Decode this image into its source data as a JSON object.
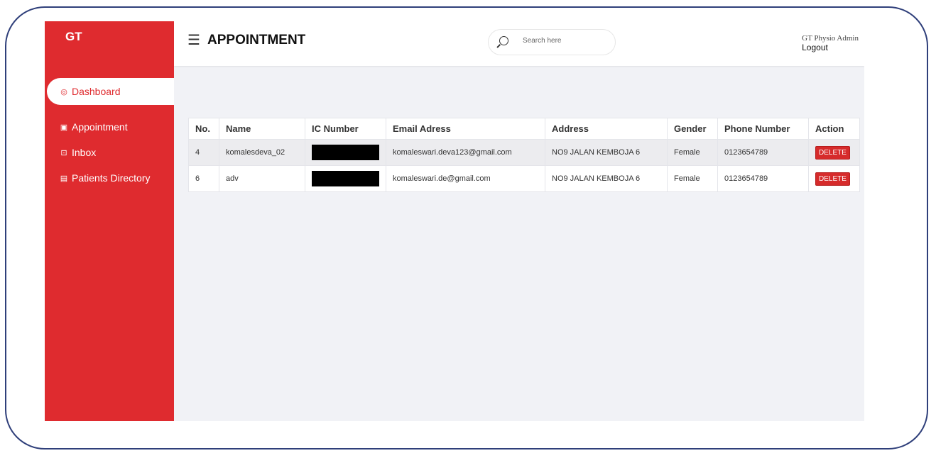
{
  "app": {
    "brand": "GT",
    "page_title": "APPOINTMENT"
  },
  "sidebar": {
    "items": [
      {
        "label": "Dashboard",
        "icon": "dashboard-icon",
        "active": true
      },
      {
        "label": "Appointment",
        "icon": "calendar-icon",
        "active": false
      },
      {
        "label": "Inbox",
        "icon": "chat-icon",
        "active": false
      },
      {
        "label": "Patients Directory",
        "icon": "contact-book-icon",
        "active": false
      }
    ]
  },
  "search": {
    "placeholder": "Search here"
  },
  "user": {
    "name": "GT Physio Admin",
    "logout": "Logout"
  },
  "table": {
    "headers": [
      "No.",
      "Name",
      "IC Number",
      "Email Adress",
      "Address",
      "Gender",
      "Phone Number",
      "Action"
    ],
    "rows": [
      {
        "no": "4",
        "name": "komalesdeva_02",
        "email": "komaleswari.deva123@gmail.com",
        "address": "NO9 JALAN KEMBOJA 6",
        "gender": "Female",
        "phone": "0123654789",
        "action": "DELETE"
      },
      {
        "no": "6",
        "name": "adv",
        "email": "komaleswari.de@gmail.com",
        "address": "NO9 JALAN KEMBOJA 6",
        "gender": "Female",
        "phone": "0123654789",
        "action": "DELETE"
      }
    ]
  },
  "colors": {
    "sidebar": "#df2b2f",
    "frame": "#2f3f7a",
    "content_bg": "#f1f2f6",
    "delete": "#d62b2b"
  }
}
